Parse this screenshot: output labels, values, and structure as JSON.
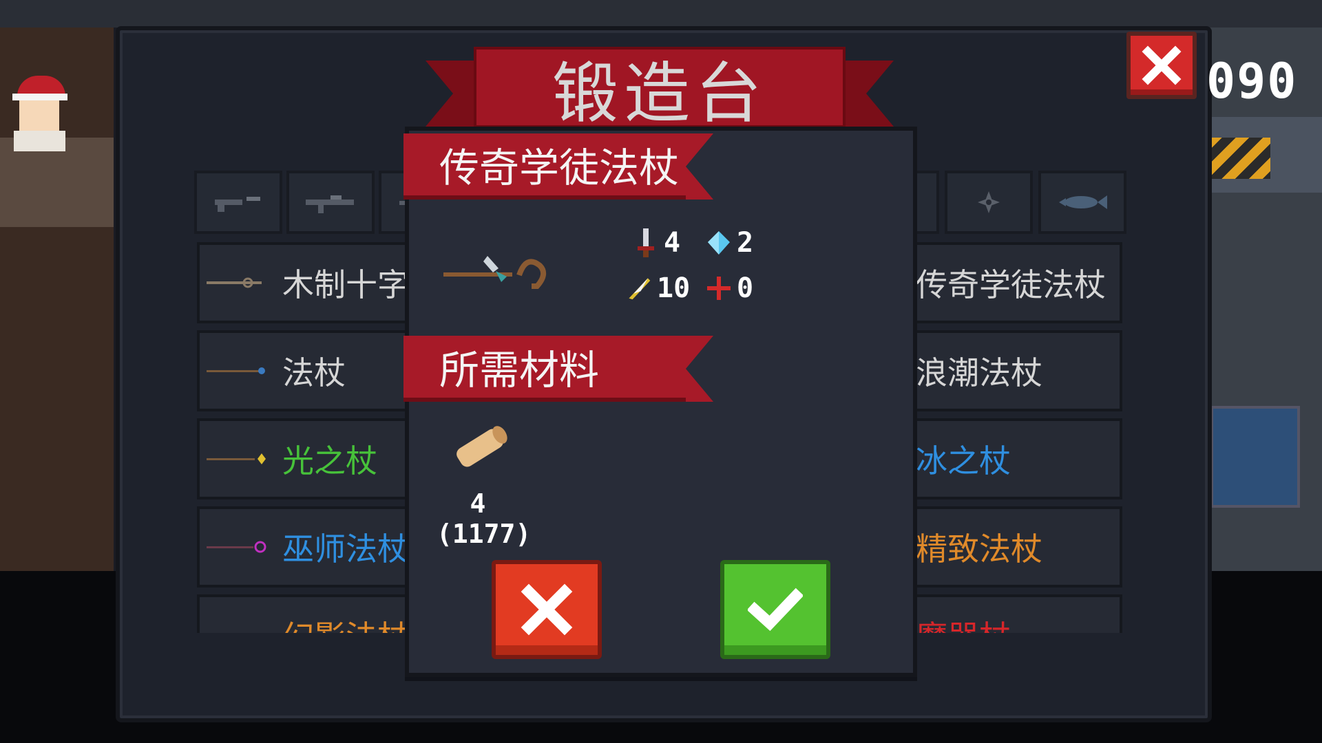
{
  "forge": {
    "title": "锻造台",
    "currency": "090"
  },
  "list": {
    "rows": [
      {
        "left": "木制十字",
        "right": "传奇学徒法杖",
        "left_color": "#d6d6d6",
        "right_color": "#d6d6d6"
      },
      {
        "left": "法杖",
        "right": "浪潮法杖",
        "left_color": "#d6d6d6",
        "right_color": "#d6d6d6"
      },
      {
        "left": "光之杖",
        "right": "冰之杖",
        "left_color": "#47c23a",
        "right_color": "#2f8fe0"
      },
      {
        "left": "巫师法杖",
        "right": "精致法杖",
        "left_color": "#2f8fe0",
        "right_color": "#e08a2a"
      },
      {
        "left": "幻影法杖",
        "right": "魔器杖",
        "left_color": "#e08a2a",
        "right_color": "#d6262a"
      }
    ]
  },
  "modal": {
    "weapon_name": "传奇学徒法杖",
    "stats": {
      "damage": "4",
      "energy": "2",
      "crit": "10",
      "accuracy": "0"
    },
    "materials_label": "所需材料",
    "material_required": "4",
    "material_owned": "(1177)"
  },
  "colors": {
    "ribbon": "#a71a28",
    "confirm": "#54c230",
    "cancel": "#e23b22"
  }
}
